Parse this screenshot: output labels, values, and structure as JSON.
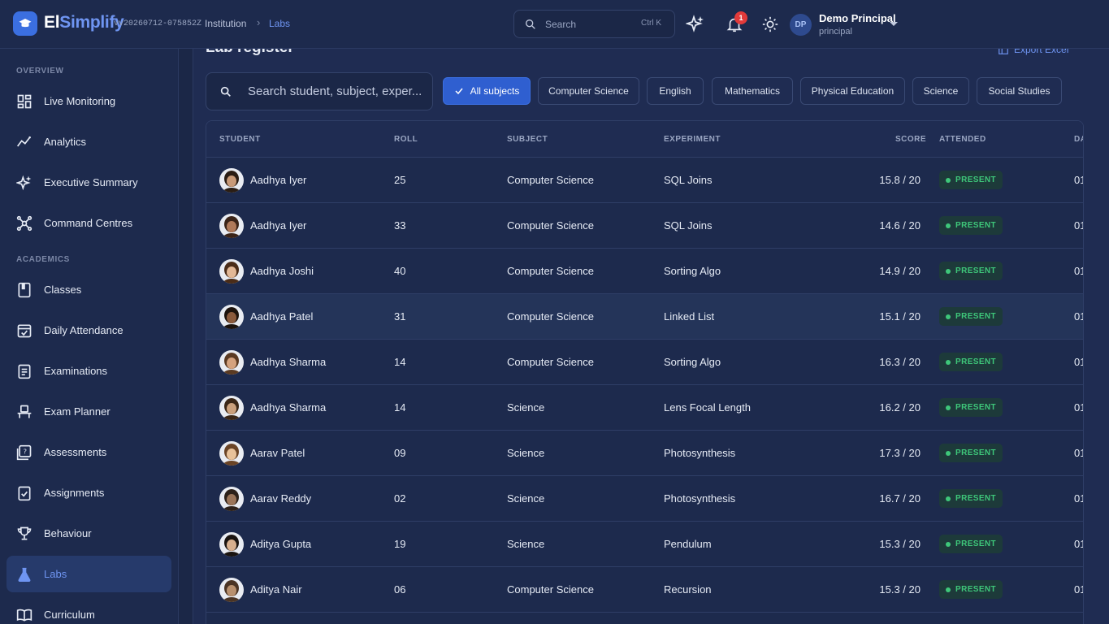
{
  "header": {
    "brand_prefix": "El",
    "brand_accent": "Simplify",
    "version": "vv20260712-075852Z",
    "breadcrumb": [
      "Institution",
      "Labs"
    ],
    "search_placeholder": "Search",
    "search_shortcut": "Ctrl K",
    "notification_count": "1",
    "user_initials": "DP",
    "user_name": "Demo Principal",
    "user_role": "principal"
  },
  "sidebar": {
    "sections": [
      {
        "label": "OVERVIEW"
      },
      {
        "label": "ACADEMICS"
      }
    ],
    "items": [
      {
        "label": "Live Monitoring",
        "icon": "dashboard-icon"
      },
      {
        "label": "Analytics",
        "icon": "analytics-icon"
      },
      {
        "label": "Executive Summary",
        "icon": "sparkles-icon"
      },
      {
        "label": "Command Centres",
        "icon": "network-icon"
      },
      {
        "label": "Classes",
        "icon": "book-icon"
      },
      {
        "label": "Daily Attendance",
        "icon": "calendar-check-icon"
      },
      {
        "label": "Examinations",
        "icon": "clipboard-icon"
      },
      {
        "label": "Exam Planner",
        "icon": "planner-icon"
      },
      {
        "label": "Assessments",
        "icon": "quiz-icon"
      },
      {
        "label": "Assignments",
        "icon": "checklist-icon"
      },
      {
        "label": "Behaviour",
        "icon": "trophy-icon"
      },
      {
        "label": "Labs",
        "icon": "flask-icon",
        "active": true
      },
      {
        "label": "Curriculum",
        "icon": "open-book-icon"
      }
    ]
  },
  "main": {
    "title": "Lab register",
    "export_label": "Export Excel",
    "search_placeholder": "Search student, subject, exper...",
    "filters": [
      "All subjects",
      "Computer Science",
      "English",
      "Mathematics",
      "Physical Education",
      "Science",
      "Social Studies"
    ],
    "columns": [
      "STUDENT",
      "ROLL",
      "SUBJECT",
      "EXPERIMENT",
      "SCORE",
      "ATTENDED",
      "DA"
    ],
    "rows": [
      {
        "student": "Aadhya Iyer",
        "roll": "25",
        "subject": "Computer Science",
        "experiment": "SQL Joins",
        "score": "15.8 / 20",
        "attended": "PRESENT",
        "date": "01"
      },
      {
        "student": "Aadhya Iyer",
        "roll": "33",
        "subject": "Computer Science",
        "experiment": "SQL Joins",
        "score": "14.6 / 20",
        "attended": "PRESENT",
        "date": "01"
      },
      {
        "student": "Aadhya Joshi",
        "roll": "40",
        "subject": "Computer Science",
        "experiment": "Sorting Algo",
        "score": "14.9 / 20",
        "attended": "PRESENT",
        "date": "01"
      },
      {
        "student": "Aadhya Patel",
        "roll": "31",
        "subject": "Computer Science",
        "experiment": "Linked List",
        "score": "15.1 / 20",
        "attended": "PRESENT",
        "date": "01"
      },
      {
        "student": "Aadhya Sharma",
        "roll": "14",
        "subject": "Computer Science",
        "experiment": "Sorting Algo",
        "score": "16.3 / 20",
        "attended": "PRESENT",
        "date": "01"
      },
      {
        "student": "Aadhya Sharma",
        "roll": "14",
        "subject": "Science",
        "experiment": "Lens Focal Length",
        "score": "16.2 / 20",
        "attended": "PRESENT",
        "date": "01"
      },
      {
        "student": "Aarav Patel",
        "roll": "09",
        "subject": "Science",
        "experiment": "Photosynthesis",
        "score": "17.3 / 20",
        "attended": "PRESENT",
        "date": "01"
      },
      {
        "student": "Aarav Reddy",
        "roll": "02",
        "subject": "Science",
        "experiment": "Photosynthesis",
        "score": "16.7 / 20",
        "attended": "PRESENT",
        "date": "01"
      },
      {
        "student": "Aditya Gupta",
        "roll": "19",
        "subject": "Science",
        "experiment": "Pendulum",
        "score": "15.3 / 20",
        "attended": "PRESENT",
        "date": "01"
      },
      {
        "student": "Aditya Nair",
        "roll": "06",
        "subject": "Computer Science",
        "experiment": "Recursion",
        "score": "15.3 / 20",
        "attended": "PRESENT",
        "date": "01"
      }
    ]
  },
  "colors": {
    "accent": "#3b6fe0",
    "present": "#3ec77a",
    "badge": "#e23a3a"
  }
}
